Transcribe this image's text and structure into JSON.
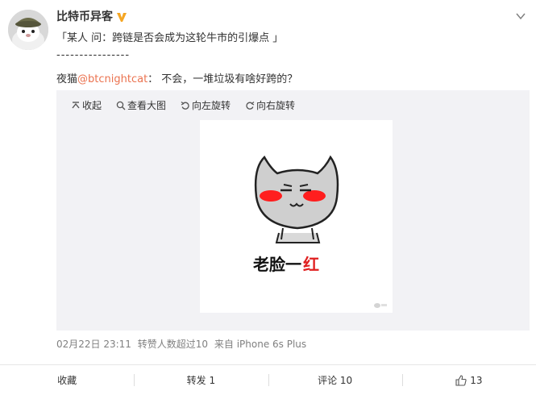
{
  "author": {
    "name": "比特币异客"
  },
  "post": {
    "line1": "「某人 问：跨链是否会成为这轮牛市的引爆点 」",
    "separator": "----------------",
    "line3_prefix": "夜猫",
    "line3_mention": "@btcnightcat",
    "line3_suffix": "： 不会，一堆垃圾有啥好跨的？"
  },
  "media": {
    "toolbar": {
      "collapse": "收起",
      "view_large": "查看大图",
      "rotate_left": "向左旋转",
      "rotate_right": "向右旋转"
    },
    "image_caption_part1": "老脸一",
    "image_caption_part2": "红"
  },
  "meta": {
    "time": "02月22日 23:11",
    "stats": "转赞人数超过10",
    "source": "来自 iPhone 6s Plus"
  },
  "actions": {
    "favorite": "收藏",
    "repost": "转发 1",
    "comment": "评论 10",
    "like_count": "13"
  },
  "colors": {
    "mention": "#eb7350",
    "verified": "#f5a623",
    "media_bg": "#f2f2f5",
    "blush": "#ff1e1e",
    "caption_accent": "#e02020"
  }
}
